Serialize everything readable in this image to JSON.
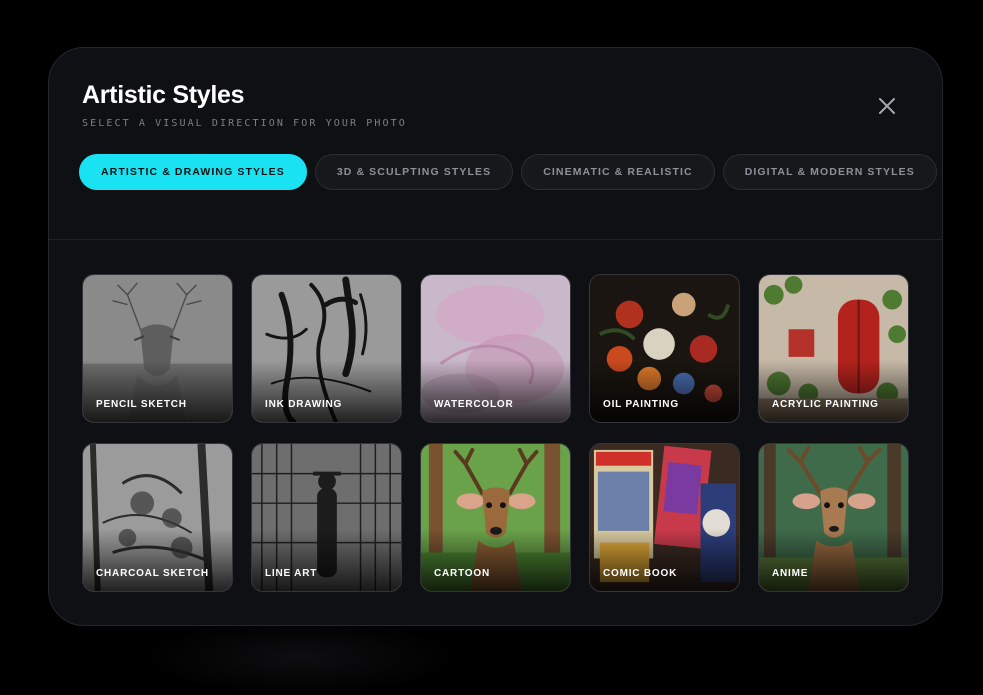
{
  "modal": {
    "title": "Artistic Styles",
    "subtitle": "SELECT A VISUAL DIRECTION FOR YOUR PHOTO",
    "close_icon": "close-icon"
  },
  "tabs": [
    {
      "label": "ARTISTIC & DRAWING STYLES",
      "active": true
    },
    {
      "label": "3D & SCULPTING STYLES",
      "active": false
    },
    {
      "label": "CINEMATIC & REALISTIC",
      "active": false
    },
    {
      "label": "DIGITAL & MODERN STYLES",
      "active": false
    },
    {
      "label": "",
      "active": false
    }
  ],
  "styles": [
    {
      "label": "PENCIL SKETCH"
    },
    {
      "label": "INK DRAWING"
    },
    {
      "label": "WATERCOLOR"
    },
    {
      "label": "OIL PAINTING"
    },
    {
      "label": "ACRYLIC PAINTING"
    },
    {
      "label": "CHARCOAL SKETCH"
    },
    {
      "label": "LINE ART"
    },
    {
      "label": "CARTOON"
    },
    {
      "label": "COMIC BOOK"
    },
    {
      "label": "ANIME"
    }
  ],
  "colors": {
    "accent": "#19e3f2",
    "background": "#000000",
    "panel": "#0f1013",
    "tab_bg": "#17181c"
  }
}
